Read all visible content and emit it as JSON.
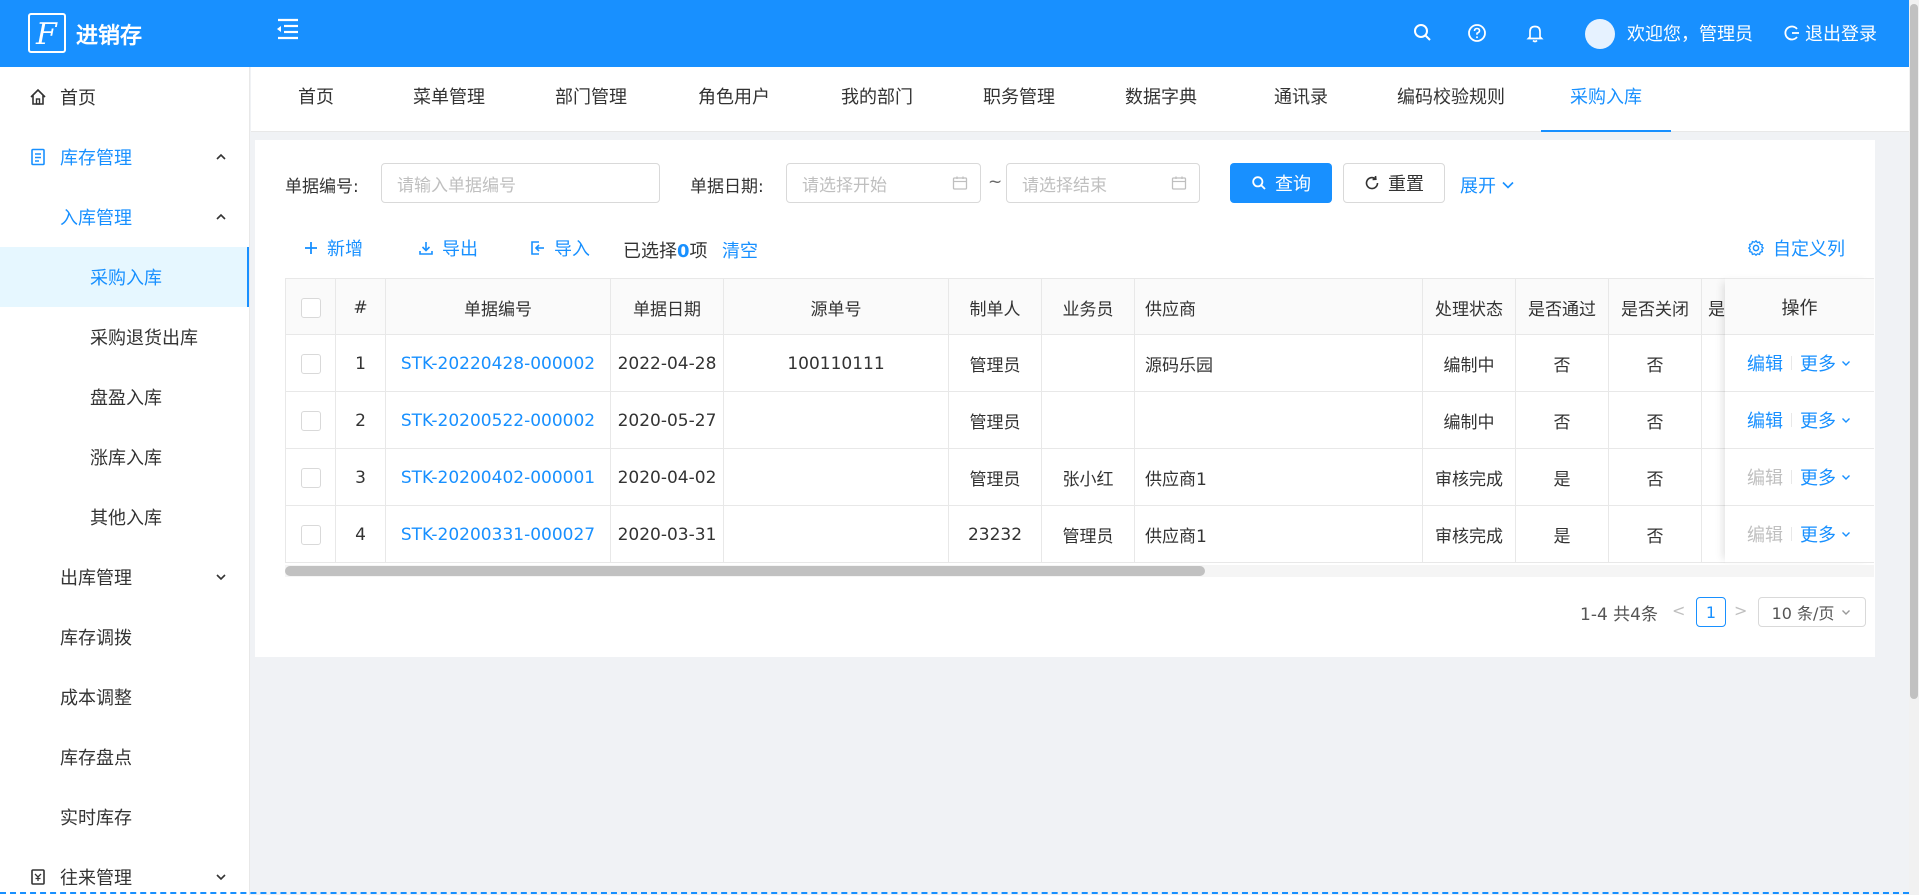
{
  "header": {
    "app_title": "进销存",
    "greeting": "欢迎您，管理员",
    "logout": "退出登录"
  },
  "sidebar": {
    "items": [
      {
        "label": "首页",
        "icon": "home-icon"
      },
      {
        "label": "库存管理",
        "icon": "inventory-icon"
      },
      {
        "label": "入库管理"
      },
      {
        "label": "采购入库"
      },
      {
        "label": "采购退货出库"
      },
      {
        "label": "盘盈入库"
      },
      {
        "label": "涨库入库"
      },
      {
        "label": "其他入库"
      },
      {
        "label": "出库管理"
      },
      {
        "label": "库存调拨"
      },
      {
        "label": "成本调整"
      },
      {
        "label": "库存盘点"
      },
      {
        "label": "实时库存"
      },
      {
        "label": "往来管理",
        "icon": "ledger-icon"
      }
    ]
  },
  "tabs": [
    "首页",
    "菜单管理",
    "部门管理",
    "角色用户",
    "我的部门",
    "职务管理",
    "数据字典",
    "通讯录",
    "编码校验规则",
    "采购入库"
  ],
  "search": {
    "bill_no_label": "单据编号:",
    "bill_no_placeholder": "请输入单据编号",
    "date_label": "单据日期:",
    "start_placeholder": "请选择开始",
    "tilde": "~",
    "end_placeholder": "请选择结束",
    "query": "查询",
    "reset": "重置",
    "expand": "展开"
  },
  "toolbar": {
    "add": "新增",
    "export": "导出",
    "import": "导入",
    "selected_prefix": "已选择",
    "selected_count": "0",
    "selected_suffix": "项",
    "clear": "清空",
    "custom_columns": "自定义列"
  },
  "table": {
    "columns": [
      "#",
      "单据编号",
      "单据日期",
      "源单号",
      "制单人",
      "业务员",
      "供应商",
      "处理状态",
      "是否通过",
      "是否关闭",
      "是"
    ],
    "op_header": "操作",
    "rows": [
      {
        "idx": "1",
        "bill_no": "STK-20220428-000002",
        "date": "2022-04-28",
        "source_no": "100110111",
        "creator": "管理员",
        "salesman": "",
        "supplier": "源码乐园",
        "status": "编制中",
        "passed": "否",
        "closed": "否",
        "edit": "编辑",
        "more": "更多"
      },
      {
        "idx": "2",
        "bill_no": "STK-20200522-000002",
        "date": "2020-05-27",
        "source_no": "",
        "creator": "管理员",
        "salesman": "",
        "supplier": "",
        "status": "编制中",
        "passed": "否",
        "closed": "否",
        "edit": "编辑",
        "more": "更多"
      },
      {
        "idx": "3",
        "bill_no": "STK-20200402-000001",
        "date": "2020-04-02",
        "source_no": "",
        "creator": "管理员",
        "salesman": "张小红",
        "supplier": "供应商1",
        "status": "审核完成",
        "passed": "是",
        "closed": "否",
        "edit": "编辑",
        "more": "更多"
      },
      {
        "idx": "4",
        "bill_no": "STK-20200331-000027",
        "date": "2020-03-31",
        "source_no": "",
        "creator": "23232",
        "salesman": "管理员",
        "supplier": "供应商1",
        "status": "审核完成",
        "passed": "是",
        "closed": "否",
        "edit": "编辑",
        "more": "更多"
      }
    ]
  },
  "pagination": {
    "total": "1-4 共4条",
    "current": "1",
    "page_size": "10 条/页"
  },
  "colors": {
    "primary": "#1890ff",
    "disabled": "#bfbfbf"
  }
}
